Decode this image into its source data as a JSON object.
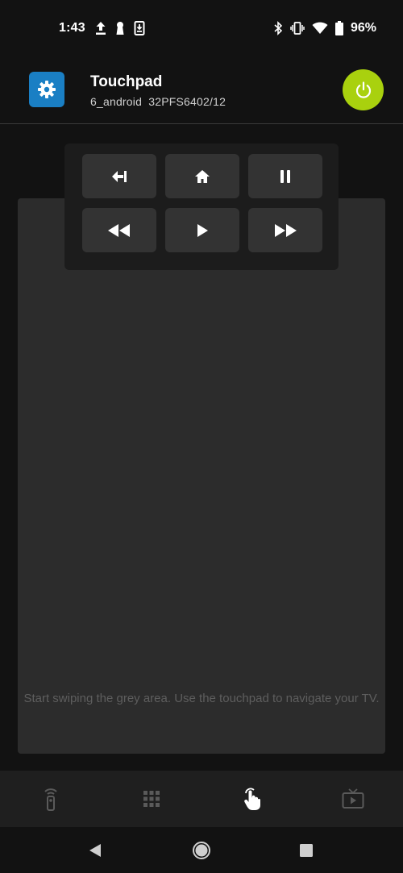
{
  "status_bar": {
    "time": "1:43",
    "battery": "96%",
    "left_icons": [
      "upload-icon",
      "keyhole-icon",
      "download-box-icon"
    ],
    "right_icons": [
      "bluetooth-icon",
      "vibrate-icon",
      "wifi-icon",
      "battery-icon"
    ]
  },
  "header": {
    "title": "Touchpad",
    "subtitle": "6_android  32PFS6402/12",
    "settings_icon": "gear-icon",
    "power_icon": "power-icon",
    "accent_color": "#a9d10e",
    "settings_color": "#1a7fc4"
  },
  "controls": {
    "row1": [
      "back-icon",
      "home-icon",
      "pause-icon"
    ],
    "row2": [
      "rewind-icon",
      "play-icon",
      "fast-forward-icon"
    ]
  },
  "touchpad": {
    "hint": "Start swiping the grey area. Use the touchpad to navigate your TV."
  },
  "tabs": [
    {
      "name": "remote",
      "icon": "remote-icon",
      "active": false
    },
    {
      "name": "numpad",
      "icon": "keypad-grid-icon",
      "active": false
    },
    {
      "name": "touchpad",
      "icon": "touch-icon",
      "active": true
    },
    {
      "name": "tv-guide",
      "icon": "tv-icon",
      "active": false
    }
  ],
  "nav": [
    "back-triangle-icon",
    "home-circle-icon",
    "recents-square-icon"
  ]
}
